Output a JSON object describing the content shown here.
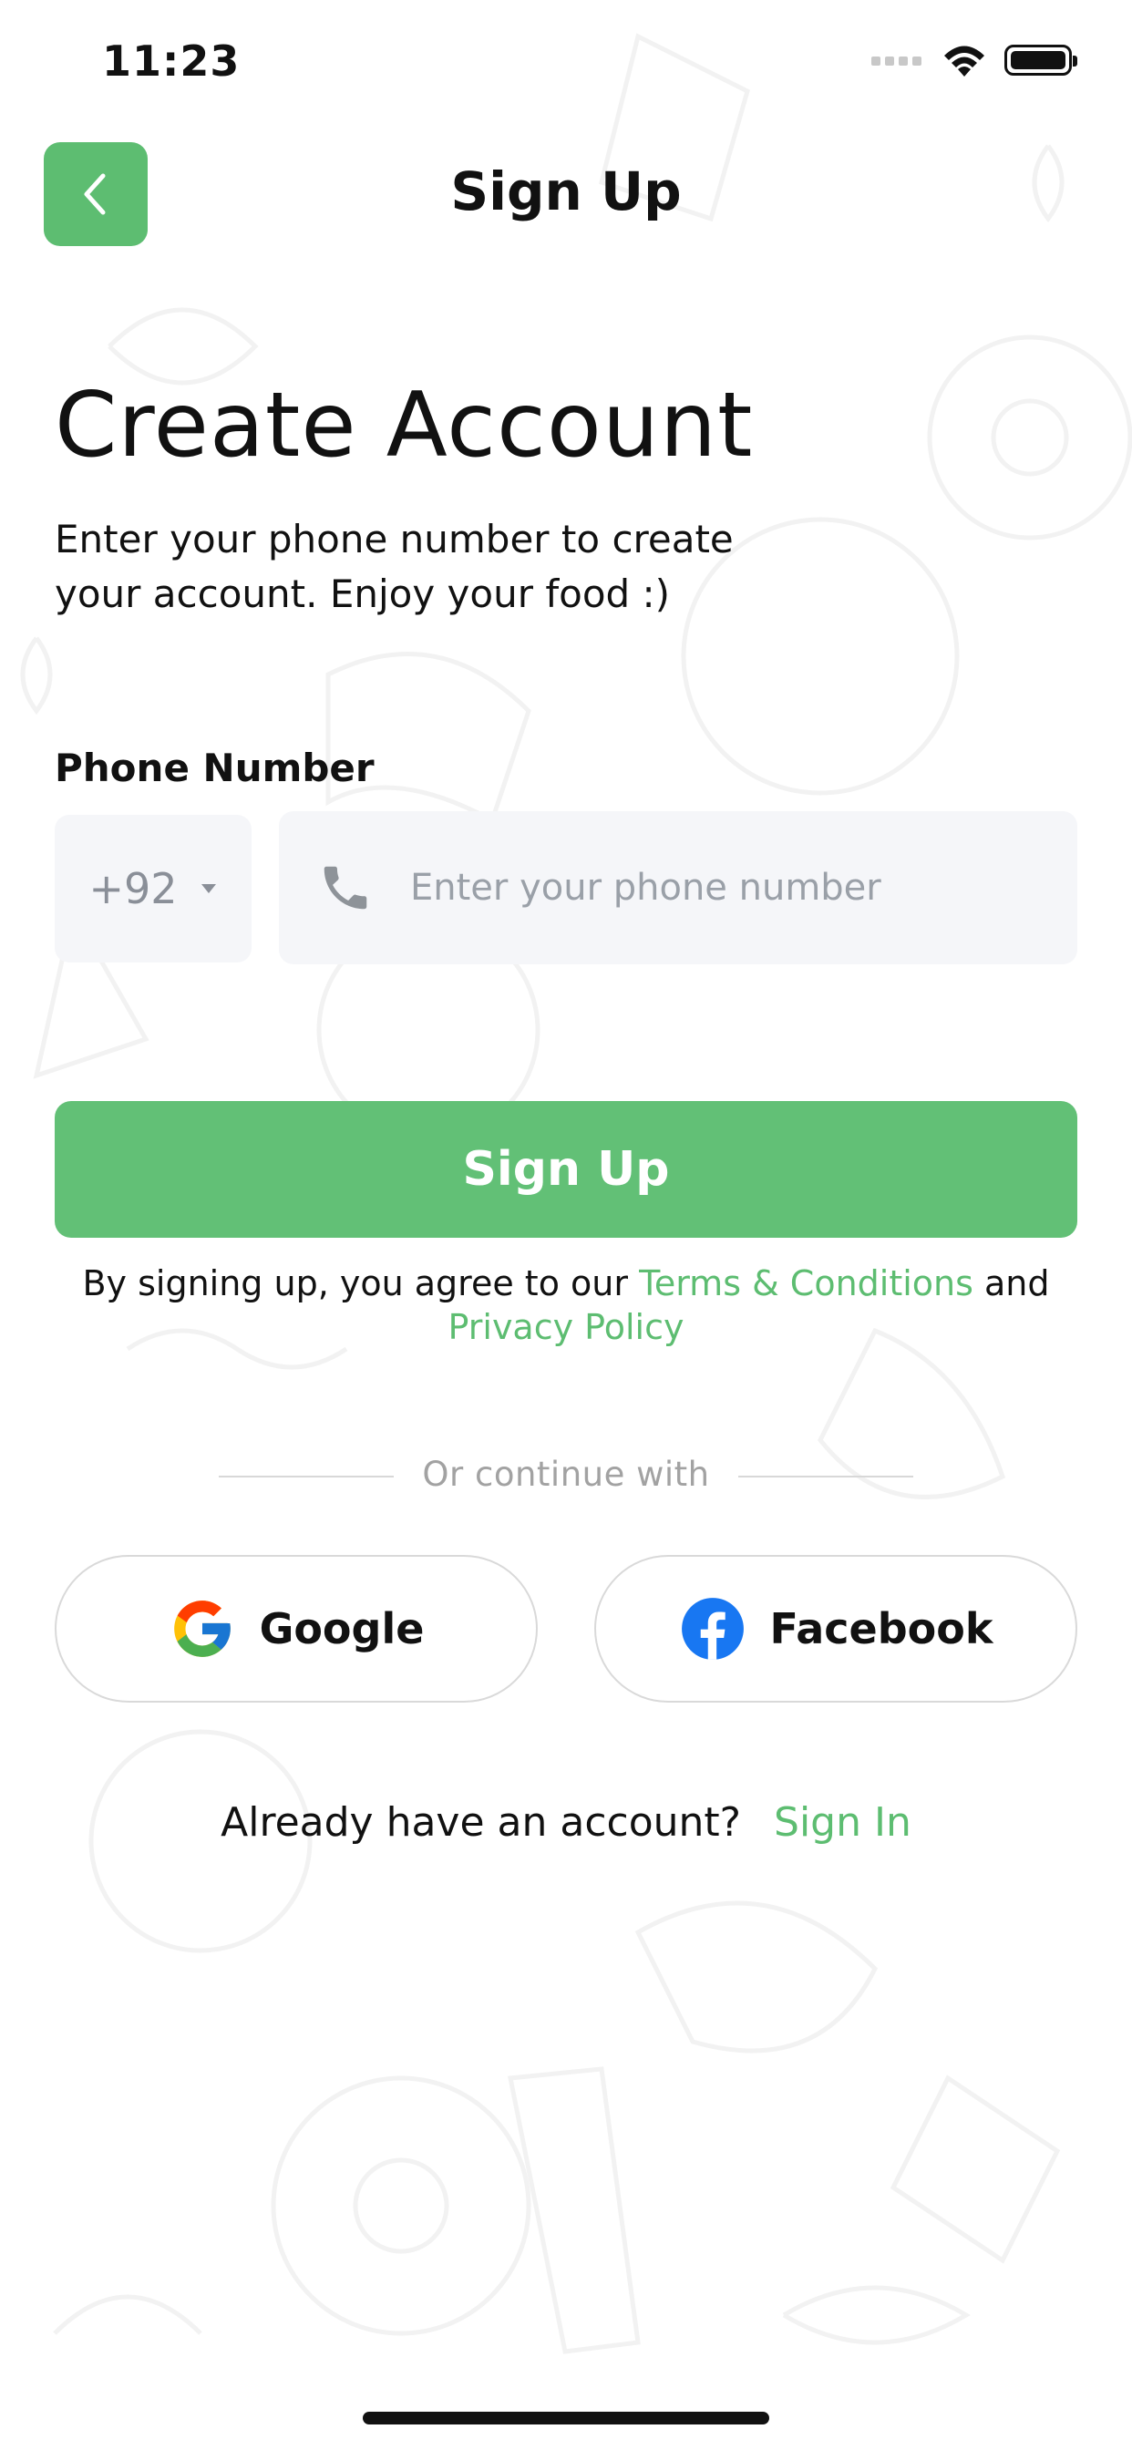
{
  "status_bar": {
    "time": "11:23"
  },
  "header": {
    "title": "Sign Up",
    "back_icon": "chevron-left-icon"
  },
  "main": {
    "heading": "Create Account",
    "subtitle_line1": "Enter your phone number to create",
    "subtitle_line2": "your account. Enjoy your food :)",
    "phone_label": "Phone Number",
    "country_code": "+92",
    "phone_placeholder": "Enter your phone number",
    "signup_button": "Sign Up",
    "terms_prefix": "By signing up, you agree to our",
    "terms_link": "Terms & Conditions",
    "terms_and": "and",
    "privacy_link": "Privacy Policy",
    "or_continue": "Or continue with",
    "google_label": "Google",
    "facebook_label": "Facebook",
    "already_text": "Already have an account?",
    "signin_link": "Sign In"
  },
  "colors": {
    "accent": "#5dbd71",
    "button": "#62c076",
    "field_bg": "#f5f6f9",
    "facebook": "#1877f2"
  }
}
